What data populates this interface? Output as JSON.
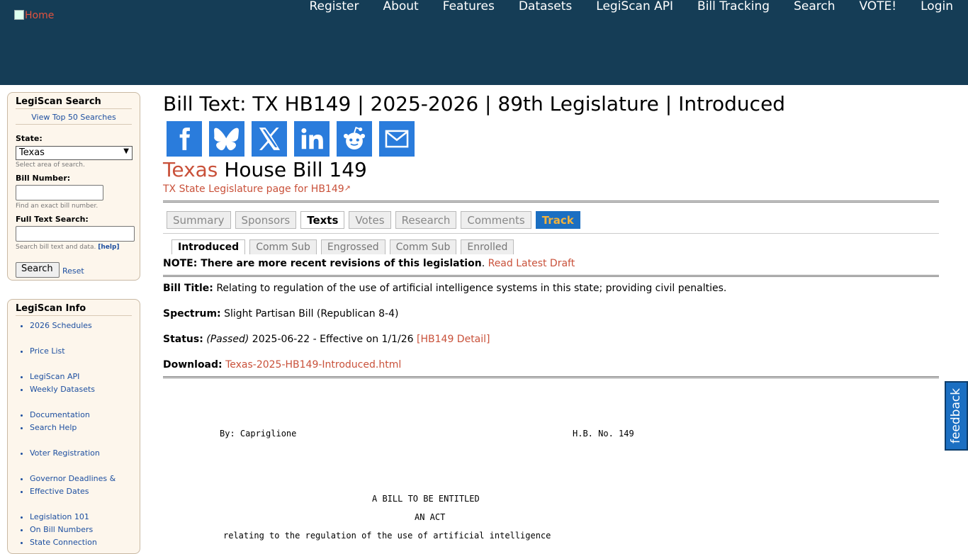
{
  "header": {
    "logo_alt": "Home",
    "nav": [
      "Register",
      "About",
      "Features",
      "Datasets",
      "LegiScan API",
      "Bill Tracking",
      "Search",
      "VOTE!",
      "Login"
    ]
  },
  "search_box": {
    "title": "LegiScan Search",
    "top_searches": "View Top 50 Searches",
    "state_label": "State:",
    "state_value": "Texas",
    "state_hint": "Select area of search.",
    "bill_number_label": "Bill Number:",
    "bill_number_value": "",
    "bill_number_hint": "Find an exact bill number.",
    "fulltext_label": "Full Text Search:",
    "fulltext_value": "",
    "fulltext_hint": "Search bill text and data.",
    "help_link": "[help]",
    "search_button": "Search",
    "reset_link": "Reset"
  },
  "info_box": {
    "title": "LegiScan Info",
    "items": [
      {
        "label": "2026 Schedules",
        "gap": false
      },
      {
        "label": "Price List",
        "gap": true
      },
      {
        "label": "LegiScan API",
        "gap": true
      },
      {
        "label": "Weekly Datasets",
        "gap": false
      },
      {
        "label": "Documentation",
        "gap": true
      },
      {
        "label": "Search Help",
        "gap": false
      },
      {
        "label": "Voter Registration",
        "gap": true
      },
      {
        "label": "Governor Deadlines &",
        "gap": true
      },
      {
        "label": "Effective Dates",
        "gap": false
      },
      {
        "label": "Legislation 101",
        "gap": true
      },
      {
        "label": "On Bill Numbers",
        "gap": false
      },
      {
        "label": "State Connection",
        "gap": false
      }
    ]
  },
  "main": {
    "page_title": "Bill Text: TX HB149 | 2025-2026 | 89th Legislature | Introduced",
    "share_icons": [
      "facebook-icon",
      "bluesky-icon",
      "x-icon",
      "linkedin-icon",
      "reddit-icon",
      "email-icon"
    ],
    "share_color": "#2a7cdc",
    "bill_state": "Texas",
    "bill_name": "House Bill 149",
    "state_link": "TX State Legislature page for HB149",
    "tabs": [
      {
        "label": "Summary",
        "state": ""
      },
      {
        "label": "Sponsors",
        "state": ""
      },
      {
        "label": "Texts",
        "state": "active"
      },
      {
        "label": "Votes",
        "state": ""
      },
      {
        "label": "Research",
        "state": ""
      },
      {
        "label": "Comments",
        "state": ""
      },
      {
        "label": "Track",
        "state": "track"
      }
    ],
    "subtabs": [
      {
        "label": "Introduced",
        "state": "active"
      },
      {
        "label": "Comm Sub",
        "state": ""
      },
      {
        "label": "Engrossed",
        "state": ""
      },
      {
        "label": "Comm Sub",
        "state": ""
      },
      {
        "label": "Enrolled",
        "state": ""
      }
    ],
    "note_text": "NOTE: There are more recent revisions of this legislation",
    "note_period": ".",
    "note_link": "Read Latest Draft",
    "bill_title_label": "Bill Title:",
    "bill_title": "Relating to regulation of the use of artificial intelligence systems in this state; providing civil penalties.",
    "spectrum_label": "Spectrum:",
    "spectrum": "Slight Partisan Bill (Republican 8-4)",
    "status_label": "Status:",
    "status_passed": "(Passed)",
    "status_text": "2025-06-22 - Effective on 1/1/26",
    "status_link": "[HB149 Detail]",
    "download_label": "Download:",
    "download_link": "Texas-2025-HB149-Introduced.html",
    "text_by": "By: Capriglione",
    "text_hb": "H.B. No. 149",
    "text_entitled": "A BILL TO BE ENTITLED",
    "text_act": "AN ACT",
    "text_relating": "relating to the regulation of the use of artificial intelligence"
  },
  "feedback": "feedback"
}
